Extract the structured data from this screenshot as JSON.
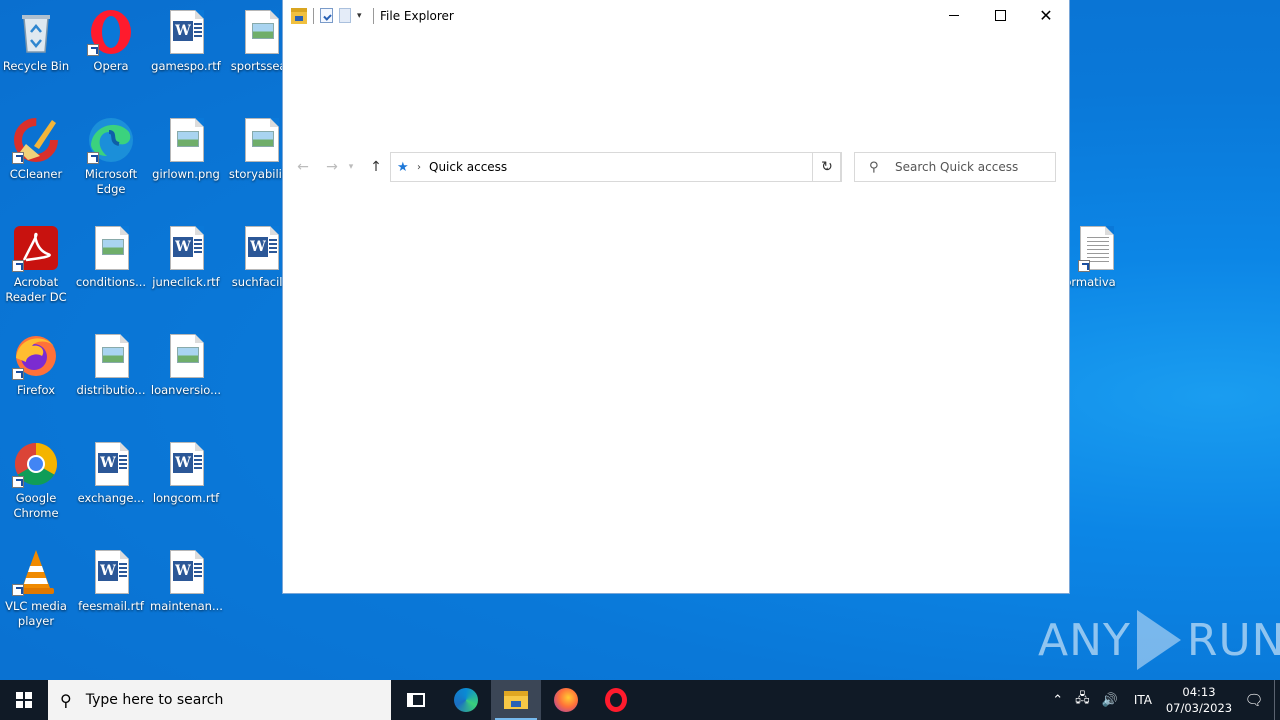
{
  "desktop": {
    "icons": [
      {
        "label": "Recycle Bin",
        "icon": "recycle-bin-icon"
      },
      {
        "label": "Opera",
        "icon": "opera-icon"
      },
      {
        "label": "gamespo.rtf",
        "icon": "word-document-icon"
      },
      {
        "label": "sportssear",
        "icon": "image-file-icon"
      },
      {
        "label": "CCleaner",
        "icon": "ccleaner-icon"
      },
      {
        "label": "Microsoft Edge",
        "icon": "edge-icon"
      },
      {
        "label": "girlown.png",
        "icon": "image-file-icon"
      },
      {
        "label": "storyability",
        "icon": "image-file-icon"
      },
      {
        "label": "Acrobat Reader DC",
        "icon": "acrobat-icon"
      },
      {
        "label": "conditions...",
        "icon": "image-file-icon"
      },
      {
        "label": "juneclick.rtf",
        "icon": "word-document-icon"
      },
      {
        "label": "suchfacilit",
        "icon": "word-document-icon"
      },
      {
        "label": "Firefox",
        "icon": "firefox-icon"
      },
      {
        "label": "distributio...",
        "icon": "image-file-icon"
      },
      {
        "label": "loanversio...",
        "icon": "image-file-icon"
      },
      {
        "label": "Google Chrome",
        "icon": "chrome-icon"
      },
      {
        "label": "exchange...",
        "icon": "word-document-icon"
      },
      {
        "label": "longcom.rtf",
        "icon": "word-document-icon"
      },
      {
        "label": "VLC media player",
        "icon": "vlc-icon"
      },
      {
        "label": "feesmail.rtf",
        "icon": "word-document-icon"
      },
      {
        "label": "maintenan...",
        "icon": "word-document-icon"
      },
      {
        "label": "ormativa",
        "icon": "text-file-icon"
      }
    ]
  },
  "explorer": {
    "title": "File Explorer",
    "address": {
      "crumb": "Quick access"
    },
    "search": {
      "placeholder": "Search Quick access"
    },
    "controls": {
      "close": "✕"
    }
  },
  "watermark": {
    "left": "ANY",
    "right": "RUN"
  },
  "taskbar": {
    "search_placeholder": "Type here to search",
    "tray": {
      "language": "ITA",
      "time": "04:13",
      "date": "07/03/2023"
    }
  }
}
